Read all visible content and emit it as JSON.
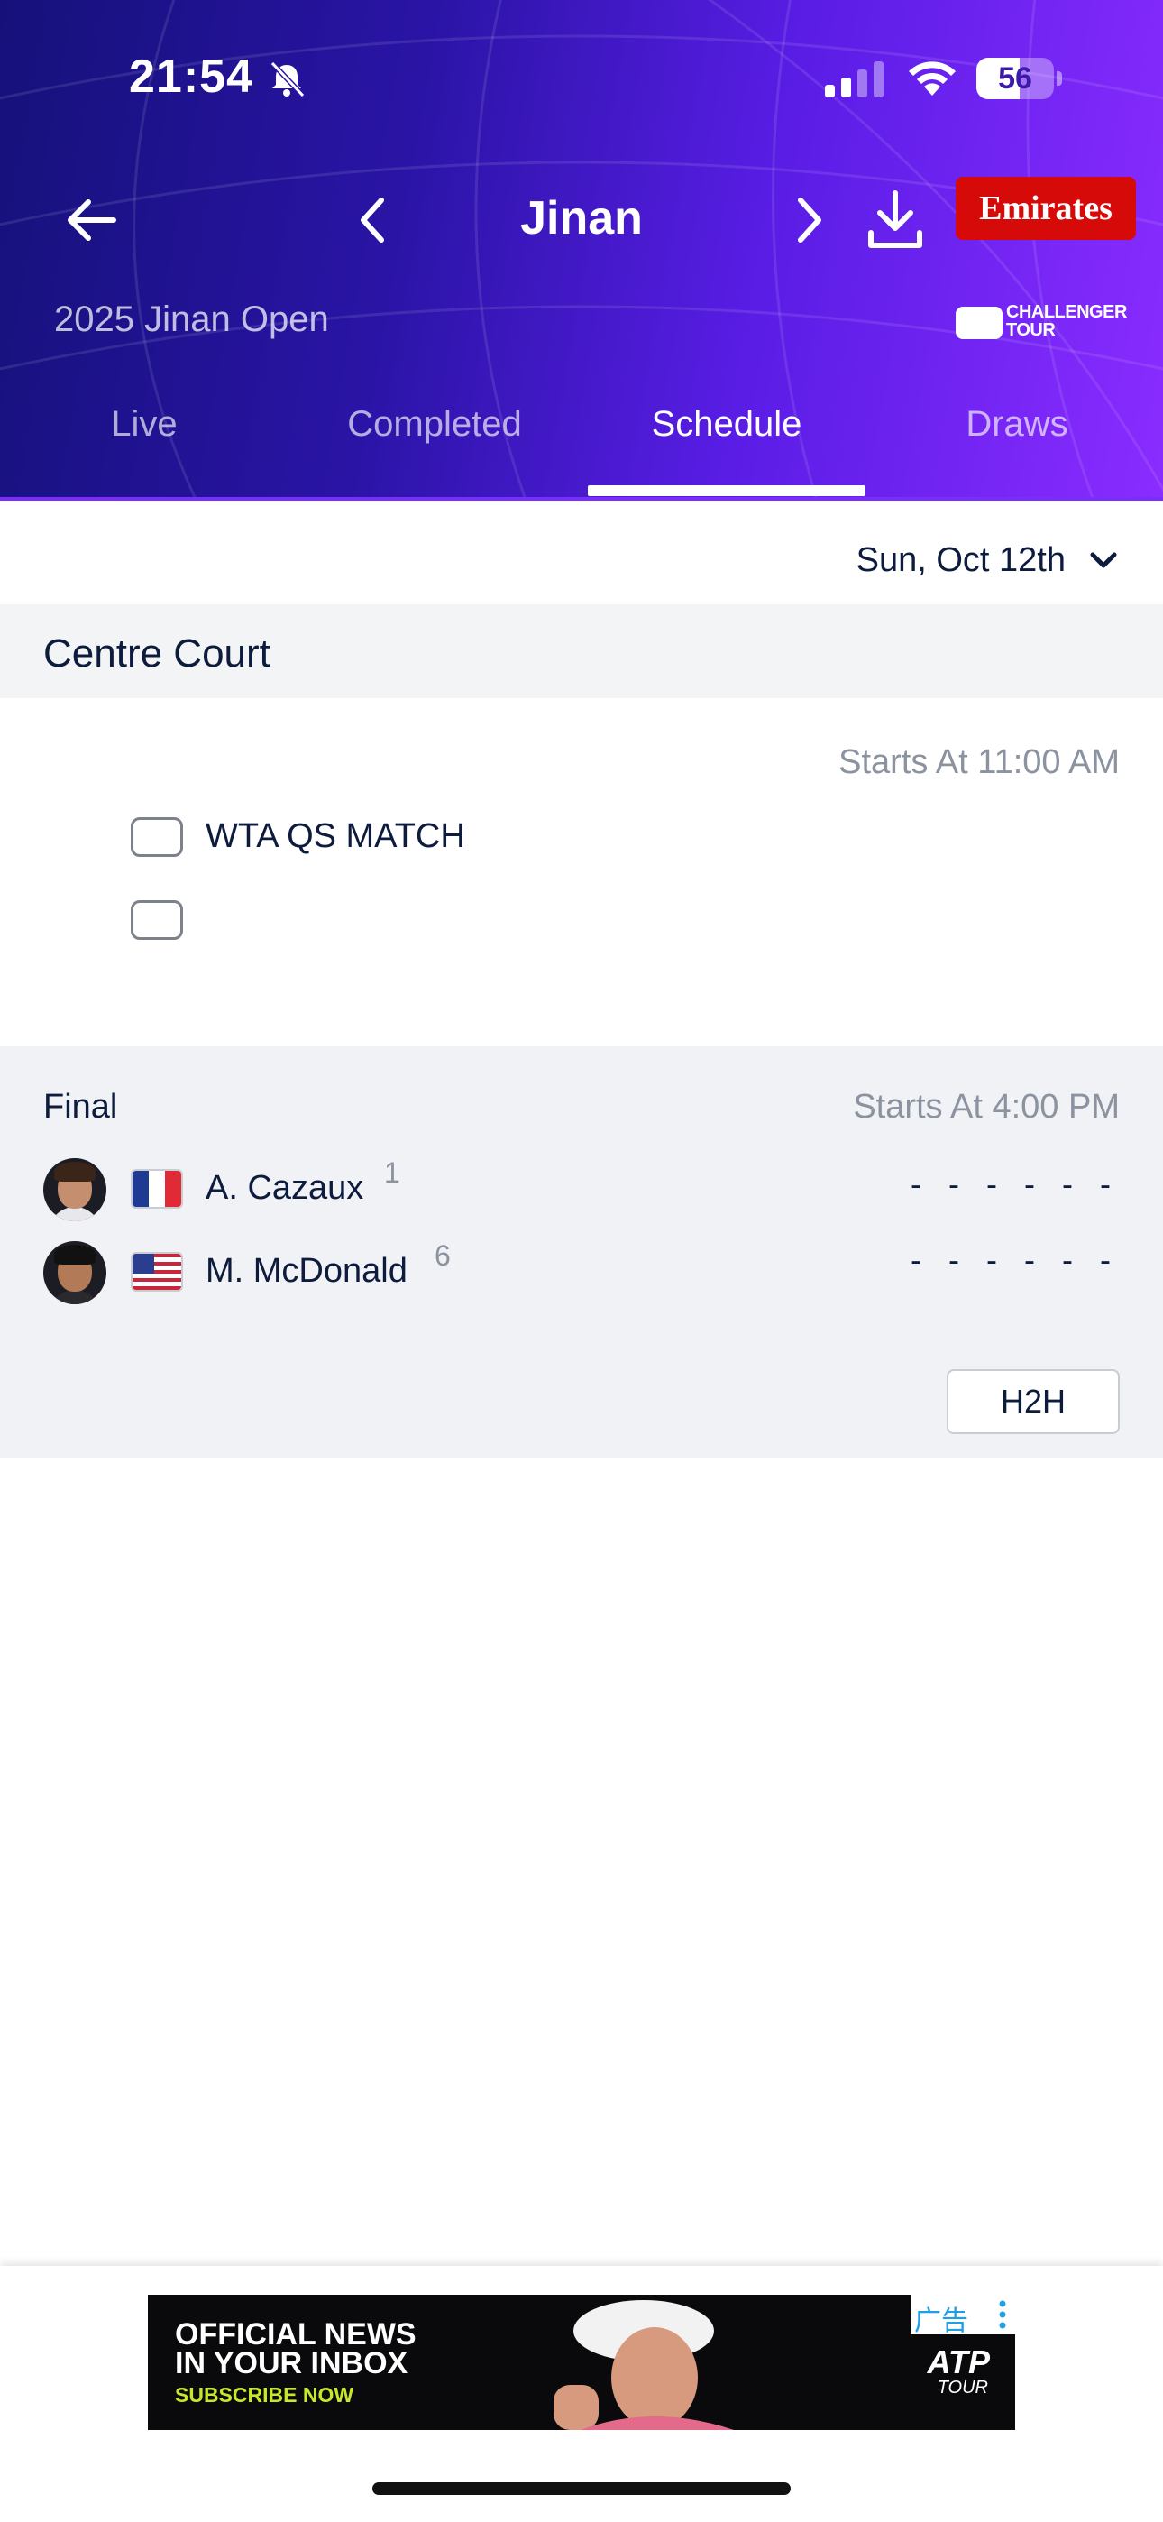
{
  "status_bar": {
    "time": "21:54",
    "battery_level": "56",
    "icons": [
      "bell-slash-icon",
      "signal-icon",
      "wifi-icon",
      "battery-icon"
    ]
  },
  "header": {
    "title": "Jinan",
    "tournament_name": "2025 Jinan Open",
    "sponsor": "Emirates",
    "tour_logo_text_1": "CHALLENGER",
    "tour_logo_text_2": "TOUR",
    "icons": [
      "back-arrow-icon",
      "chevron-left-icon",
      "chevron-right-icon",
      "download-icon"
    ]
  },
  "tabs": [
    {
      "label": "Live",
      "active": false
    },
    {
      "label": "Completed",
      "active": false
    },
    {
      "label": "Schedule",
      "active": true
    },
    {
      "label": "Draws",
      "active": false
    }
  ],
  "date_selector": {
    "value": "Sun, Oct 12th"
  },
  "court": {
    "name": "Centre Court",
    "matches": [
      {
        "start": "Starts At 11:00 AM",
        "label": "WTA QS MATCH"
      },
      {
        "round": "Final",
        "start": "Starts At 4:00 PM",
        "players": [
          {
            "name": "A. Cazaux",
            "seed": "1",
            "country": "France",
            "score": "- - - - - -"
          },
          {
            "name": "M. McDonald",
            "seed": "6",
            "country": "United States",
            "score": "- - - - - -"
          }
        ],
        "h2h_label": "H2H"
      }
    ]
  },
  "ad": {
    "line1": "OFFICIAL NEWS",
    "line2": "IN YOUR INBOX",
    "line3": "SUBSCRIBE NOW",
    "badge": "广告",
    "brand": "ATP",
    "brand_sub": "TOUR"
  },
  "colors": {
    "header_gradient_start": "#15117a",
    "header_gradient_end": "#8a2cff",
    "sponsor_red": "#d70a0a",
    "text_dark": "#0d1b3d",
    "text_muted": "#8b93a1",
    "section_bg": "#f1f2f5"
  }
}
